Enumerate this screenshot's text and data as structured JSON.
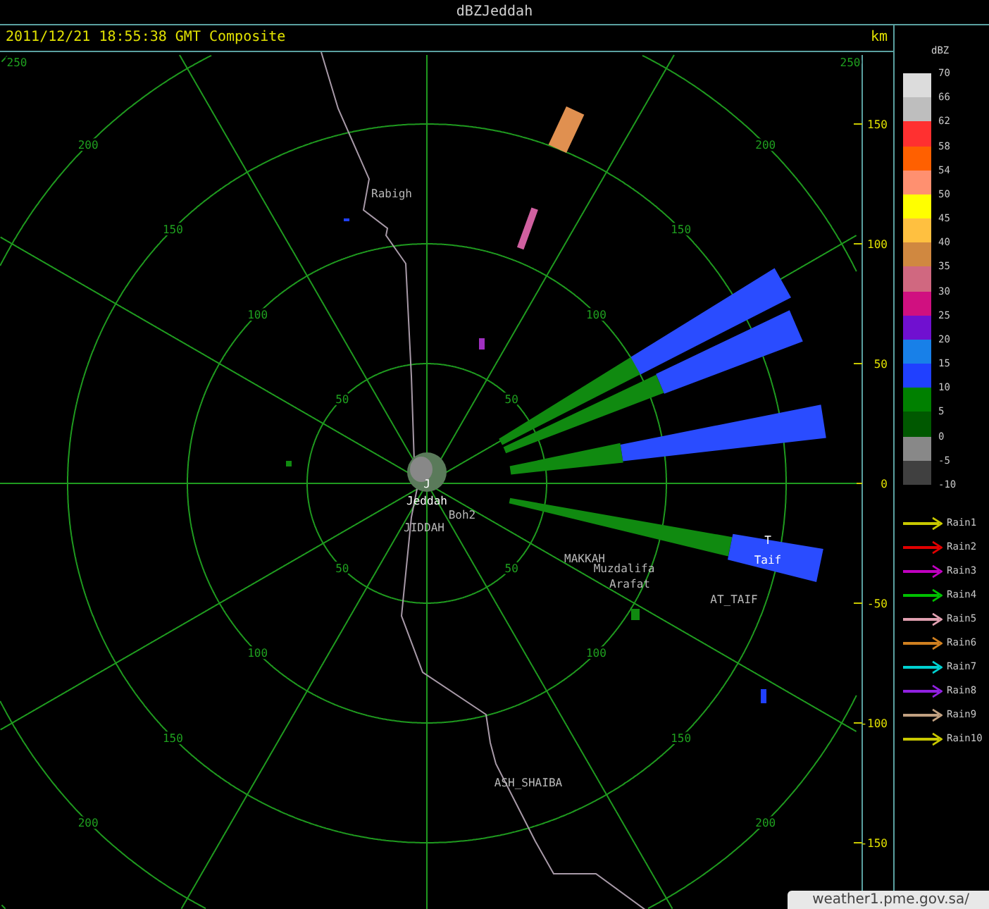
{
  "window": {
    "title": "dBZJeddah"
  },
  "header": {
    "timestamp": "2011/12/21 18:55:38 GMT Composite",
    "units": "km"
  },
  "plot": {
    "rings": [
      {
        "ne": "250",
        "nw": "250"
      },
      {
        "ne": "200",
        "nw": "200",
        "sw": "200",
        "se": "200"
      },
      {
        "ne": "150",
        "nw": "150",
        "sw": "150",
        "se": "150"
      },
      {
        "ne": "100",
        "nw": "100",
        "sw": "100",
        "se": "100"
      },
      {
        "ne": "50",
        "nw": "50",
        "sw": "50",
        "se": "50"
      }
    ],
    "y_ticks": [
      "150",
      "100",
      "50",
      "0",
      "-50",
      "-100",
      "-150"
    ],
    "places": [
      {
        "name": "Rabigh",
        "kind": "town"
      },
      {
        "name": "J",
        "kind": "radar"
      },
      {
        "name": "Jeddah",
        "kind": "radar"
      },
      {
        "name": "Boh2",
        "kind": "town"
      },
      {
        "name": "JIDDAH",
        "kind": "town"
      },
      {
        "name": "MAKKAH",
        "kind": "town"
      },
      {
        "name": "Muzdalifa",
        "kind": "town"
      },
      {
        "name": "Arafat",
        "kind": "town"
      },
      {
        "name": "AT_TAIF",
        "kind": "town"
      },
      {
        "name": "T",
        "kind": "radar"
      },
      {
        "name": "Taif",
        "kind": "radar"
      },
      {
        "name": "ASH_SHAIBA",
        "kind": "town"
      }
    ]
  },
  "color_scale": {
    "title": "dBZ",
    "bins": [
      {
        "color": "#dcdcdc"
      },
      {
        "color": "#bebebe"
      },
      {
        "color": "#ff3030"
      },
      {
        "color": "#ff6000"
      },
      {
        "color": "#ff9070"
      },
      {
        "color": "#ffff00"
      },
      {
        "color": "#ffc040"
      },
      {
        "color": "#d08840"
      },
      {
        "color": "#d06880"
      },
      {
        "color": "#d01080"
      },
      {
        "color": "#7010d0"
      },
      {
        "color": "#1880e8"
      },
      {
        "color": "#2040ff"
      },
      {
        "color": "#008000"
      },
      {
        "color": "#005800"
      },
      {
        "color": "#888888"
      },
      {
        "color": "#404040"
      }
    ],
    "labels": [
      "70",
      "66",
      "62",
      "58",
      "54",
      "50",
      "45",
      "40",
      "35",
      "30",
      "25",
      "20",
      "15",
      "10",
      "5",
      "0",
      "-5",
      "-10"
    ]
  },
  "rain_legend": [
    {
      "label": "Rain1",
      "color": "#c8c800"
    },
    {
      "label": "Rain2",
      "color": "#e00000"
    },
    {
      "label": "Rain3",
      "color": "#c000c0"
    },
    {
      "label": "Rain4",
      "color": "#00c000"
    },
    {
      "label": "Rain5",
      "color": "#e0a0b0"
    },
    {
      "label": "Rain6",
      "color": "#d08020"
    },
    {
      "label": "Rain7",
      "color": "#00d0d0"
    },
    {
      "label": "Rain8",
      "color": "#9020e0"
    },
    {
      "label": "Rain9",
      "color": "#c0a080"
    },
    {
      "label": "Rain10",
      "color": "#c8c801"
    }
  ],
  "status_tooltip": {
    "text": "weather1.pme.gov.sa/"
  }
}
